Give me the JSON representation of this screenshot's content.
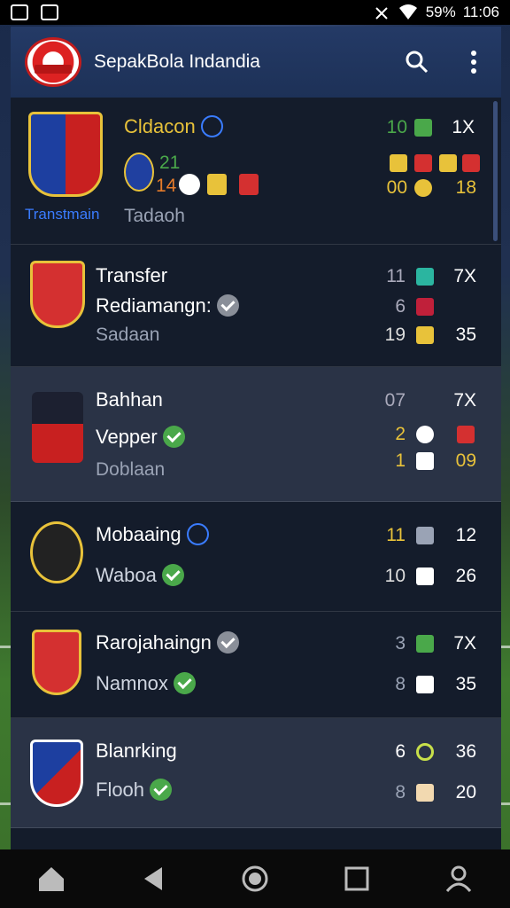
{
  "status_bar": {
    "battery": "59%",
    "time": "11:06"
  },
  "app_bar": {
    "title": "SepakBola Indandia"
  },
  "rows": [
    {
      "name": "Cldacon",
      "sub": "Tadaoh",
      "badge_caption": "Transtmain",
      "stats": {
        "a": "10",
        "b": "1X",
        "c": "00",
        "d": "18",
        "e": "21",
        "f": "14"
      },
      "accent": "#e8c23a"
    },
    {
      "name": "Transfer",
      "sub": "Rediamangn:",
      "sub2": "Sadaan",
      "stats": {
        "a": "11",
        "b": "7X",
        "c": "6",
        "d": "19",
        "e": "35"
      }
    },
    {
      "name": "Bahhan",
      "sub": "Vepper",
      "sub2": "Doblaan",
      "stats": {
        "a": "07",
        "b": "7X",
        "c": "2",
        "d": "1",
        "e": "09"
      }
    },
    {
      "name": "Mobaaing",
      "sub": "Waboa",
      "stats": {
        "a": "11",
        "b": "12",
        "c": "10",
        "d": "26"
      }
    },
    {
      "name": "Rarojahaingn",
      "sub": "Namnox",
      "stats": {
        "a": "3",
        "b": "7X",
        "c": "8",
        "d": "35"
      }
    },
    {
      "name": "Blanrking",
      "sub": "Flooh",
      "stats": {
        "a": "6",
        "b": "36",
        "c": "8",
        "d": "20"
      }
    }
  ],
  "colors": {
    "green": "#4aa84a",
    "yellow": "#e8c23a",
    "red": "#d43030",
    "accent_blue": "#3a7cff"
  },
  "nav": [
    "home-icon",
    "back-icon",
    "home-circle-icon",
    "recents-icon",
    "profile-icon"
  ]
}
